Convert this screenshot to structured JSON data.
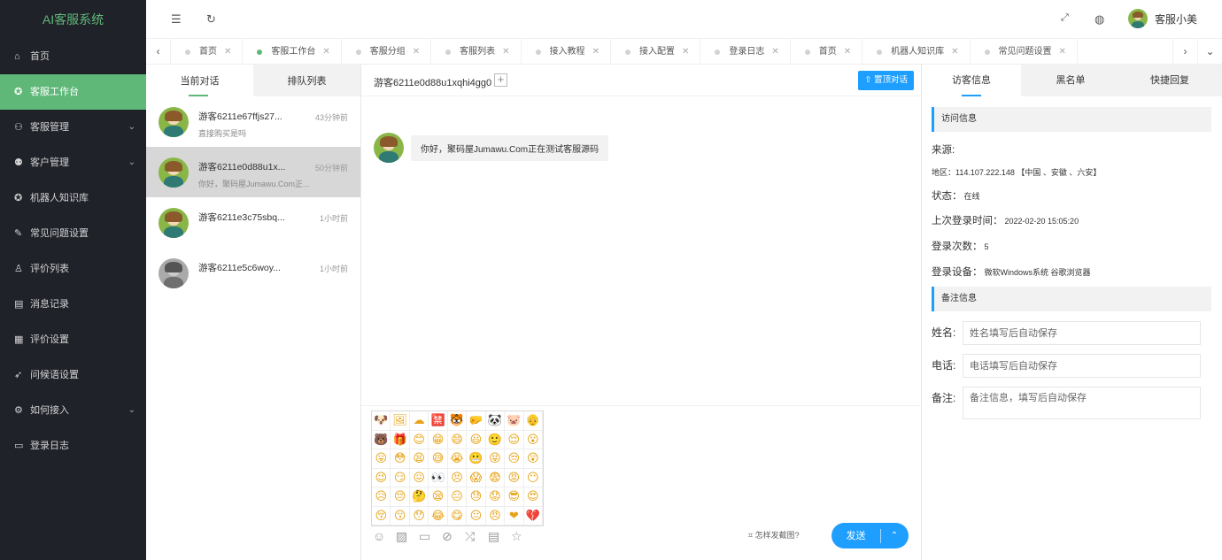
{
  "sidebar": {
    "logo": "AI客服系统",
    "items": [
      {
        "label": "首页",
        "icon": "home-icon",
        "glyph": "⌂",
        "active": false,
        "expandable": false
      },
      {
        "label": "客服工作台",
        "icon": "workbench-icon",
        "glyph": "✪",
        "active": true,
        "expandable": false
      },
      {
        "label": "客服管理",
        "icon": "user-icon",
        "glyph": "⚇",
        "active": false,
        "expandable": true
      },
      {
        "label": "客户管理",
        "icon": "customer-icon",
        "glyph": "⚉",
        "active": false,
        "expandable": true
      },
      {
        "label": "机器人知识库",
        "icon": "robot-icon",
        "glyph": "✪",
        "active": false,
        "expandable": false
      },
      {
        "label": "常见问题设置",
        "icon": "faq-icon",
        "glyph": "✎",
        "active": false,
        "expandable": false
      },
      {
        "label": "评价列表",
        "icon": "thumb-icon",
        "glyph": "♙",
        "active": false,
        "expandable": false
      },
      {
        "label": "消息记录",
        "icon": "message-icon",
        "glyph": "▤",
        "active": false,
        "expandable": false
      },
      {
        "label": "评价设置",
        "icon": "calendar-icon",
        "glyph": "▦",
        "active": false,
        "expandable": false
      },
      {
        "label": "问候语设置",
        "icon": "send-icon",
        "glyph": "➶",
        "active": false,
        "expandable": false
      },
      {
        "label": "如何接入",
        "icon": "settings-icon",
        "glyph": "⚙",
        "active": false,
        "expandable": true
      },
      {
        "label": "登录日志",
        "icon": "log-icon",
        "glyph": "▭",
        "active": false,
        "expandable": false
      }
    ]
  },
  "header": {
    "user_name": "客服小美"
  },
  "tabs": [
    {
      "label": "首页",
      "active": false
    },
    {
      "label": "客服工作台",
      "active": true
    },
    {
      "label": "客服分组",
      "active": false
    },
    {
      "label": "客服列表",
      "active": false
    },
    {
      "label": "接入教程",
      "active": false
    },
    {
      "label": "接入配置",
      "active": false
    },
    {
      "label": "登录日志",
      "active": false
    },
    {
      "label": "首页",
      "active": false
    },
    {
      "label": "机器人知识库",
      "active": false
    },
    {
      "label": "常见问题设置",
      "active": false
    }
  ],
  "conv_panel": {
    "tab_current": "当前对话",
    "tab_queue": "排队列表",
    "conversations": [
      {
        "name": "游客6211e67ffjs27...",
        "preview": "直接购买是吗",
        "time": "43分钟前",
        "active": false,
        "online": true
      },
      {
        "name": "游客6211e0d88u1x...",
        "preview": "你好，聚码屋Jumawu.Com正...",
        "time": "50分钟前",
        "active": true,
        "online": true
      },
      {
        "name": "游客6211e3c75sbq...",
        "preview": "",
        "time": "1小时前",
        "active": false,
        "online": true
      },
      {
        "name": "游客6211e5c6woy...",
        "preview": "",
        "time": "1小时前",
        "active": false,
        "online": false
      }
    ]
  },
  "chat": {
    "title": "游客6211e0d88u1xqhi4gg0",
    "top_button": "置顶对话",
    "message": "你好，聚码屋Jumawu.Com正在测试客服源码",
    "screenshot_tip": "怎样发截图?",
    "send_label": "发送",
    "emojis": [
      "🐶",
      "🖼",
      "☁",
      "🈲",
      "🐯",
      "🤛",
      "🐼",
      "🐷",
      "👴",
      "🐻",
      "🎁",
      "😊",
      "😁",
      "😄",
      "😃",
      "🙂",
      "😌",
      "😮",
      "😛",
      "😳",
      "😫",
      "😅",
      "😭",
      "😬",
      "😝",
      "😒",
      "😲",
      "😉",
      "😏",
      "😖",
      "👀",
      "😣",
      "😱",
      "😨",
      "😡",
      "😶",
      "😥",
      "😔",
      "🤔",
      "😪",
      "😑",
      "😓",
      "😟",
      "😎",
      "😍",
      "😚",
      "😗",
      "😯",
      "😂",
      "😋",
      "😐",
      "😠",
      "❤",
      "💔"
    ]
  },
  "info_panel": {
    "tabs": [
      "访客信息",
      "黑名单",
      "快捷回复"
    ],
    "visit_header": "访问信息",
    "source_label": "来源:",
    "region": "地区：114.107.222.148 【中国 、安徽 、六安】",
    "status_label": "状态：",
    "status_value": "在线",
    "last_login_label": "上次登录时间：",
    "last_login_value": "2022-02-20 15:05:20",
    "login_count_label": "登录次数：",
    "login_count_value": "5",
    "device_label": "登录设备：",
    "device_value": "微软Windows系统 谷歌浏览器",
    "remark_header": "备注信息",
    "name_label": "姓名:",
    "name_placeholder": "姓名填写后自动保存",
    "phone_label": "电话:",
    "phone_placeholder": "电话填写后自动保存",
    "note_label": "备注:",
    "note_placeholder": "备注信息，填写后自动保存"
  }
}
